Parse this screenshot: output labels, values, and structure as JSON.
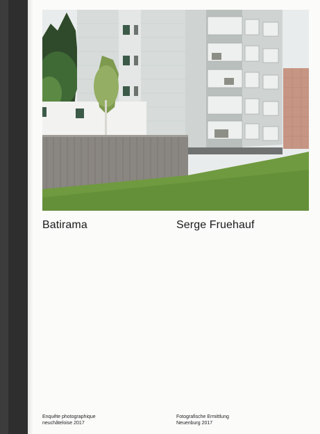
{
  "cover": {
    "title": "Batirama",
    "author": "Serge Fruehauf",
    "footer_left": [
      "Enquête photographique",
      "neuchâteloise 2017"
    ],
    "footer_right": [
      "Fotografische Ermittlung",
      "Neuenburg 2017"
    ]
  },
  "colors": {
    "spine": "#2e2e2e",
    "page": "#fbfbfa",
    "text": "#1a1a1a"
  }
}
